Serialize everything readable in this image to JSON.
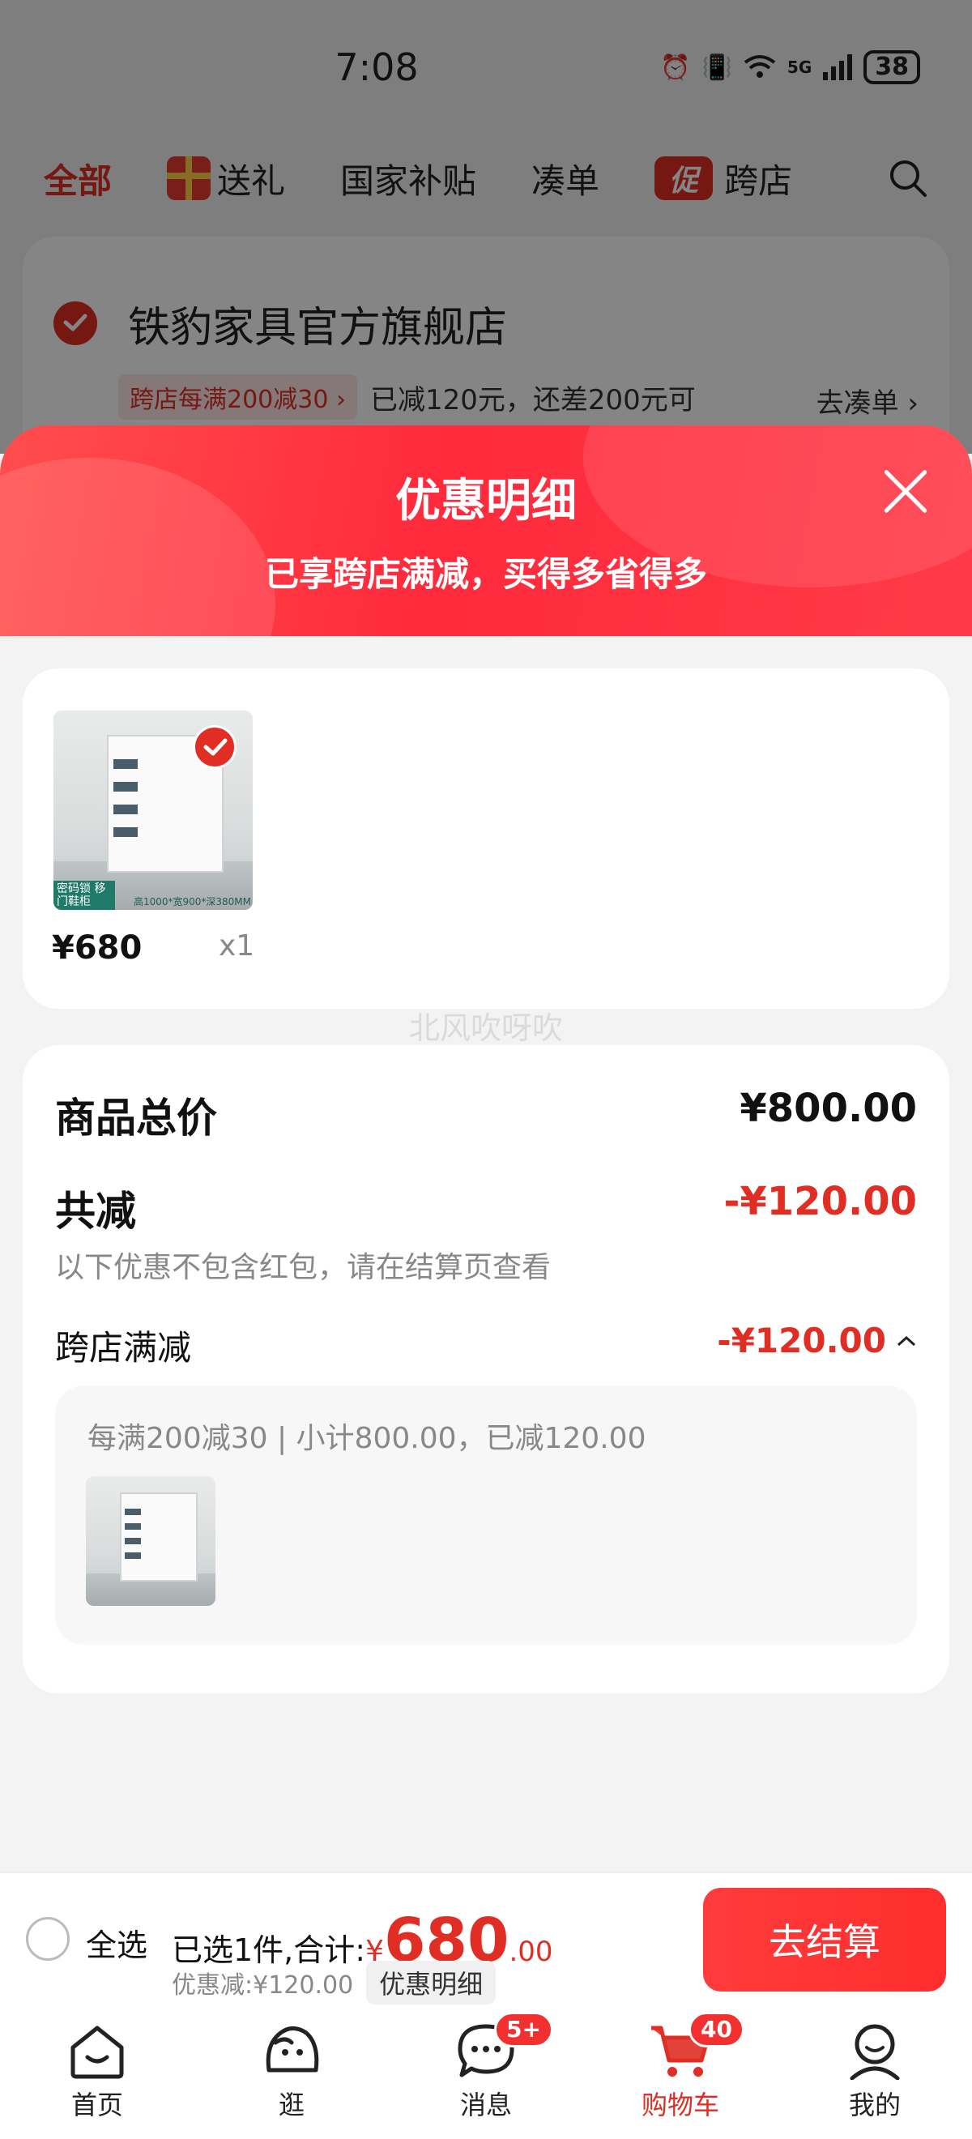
{
  "status_bar": {
    "time": "7:08",
    "network": "5G",
    "battery": "38"
  },
  "top_tabs": [
    {
      "label": "全部"
    },
    {
      "label": "送礼"
    },
    {
      "label": "国家补贴"
    },
    {
      "label": "凑单"
    },
    {
      "label": "跨店",
      "badge": "促"
    }
  ],
  "store": {
    "name": "铁豹家具官方旗舰店",
    "promo_tag": "跨店每满200减30 ›",
    "promo_text": "已减120元，还差200元可",
    "collect_link": "去凑单 ›"
  },
  "sheet": {
    "title": "优惠明细",
    "subtitle": "已享跨店满减，买得多省得多"
  },
  "item": {
    "price": "¥680",
    "qty": "x1",
    "image_badge": "密码锁 移门鞋柜",
    "image_caption": "高1000*宽900*深380MM"
  },
  "watermark": "北风吹呀吹",
  "summary": {
    "total_label": "商品总价",
    "total_value": "¥800.00",
    "discount_label": "共减",
    "discount_value": "-¥120.00",
    "note": "以下优惠不包含红包，请在结算页查看",
    "cross_store_label": "跨店满减",
    "cross_store_value": "-¥120.00",
    "detail_text": "每满200减30 | 小计800.00，已减120.00"
  },
  "checkout": {
    "select_all": "全选",
    "selected_prefix": "已选1件,合计:",
    "currency": "¥",
    "total_int": "680",
    "total_dec": ".00",
    "discount_text": "优惠减:¥120.00",
    "detail_chip": "优惠明细",
    "button": "去结算"
  },
  "tabbar": [
    {
      "label": "首页",
      "icon": "home-icon"
    },
    {
      "label": "逛",
      "icon": "browse-icon"
    },
    {
      "label": "消息",
      "icon": "message-icon",
      "badge": "5+"
    },
    {
      "label": "购物车",
      "icon": "cart-icon",
      "badge": "40",
      "active": true
    },
    {
      "label": "我的",
      "icon": "profile-icon"
    }
  ],
  "colors": {
    "accent": "#e02e24",
    "header_gradient_start": "#ff4d4d",
    "header_gradient_end": "#ff2a3c"
  }
}
